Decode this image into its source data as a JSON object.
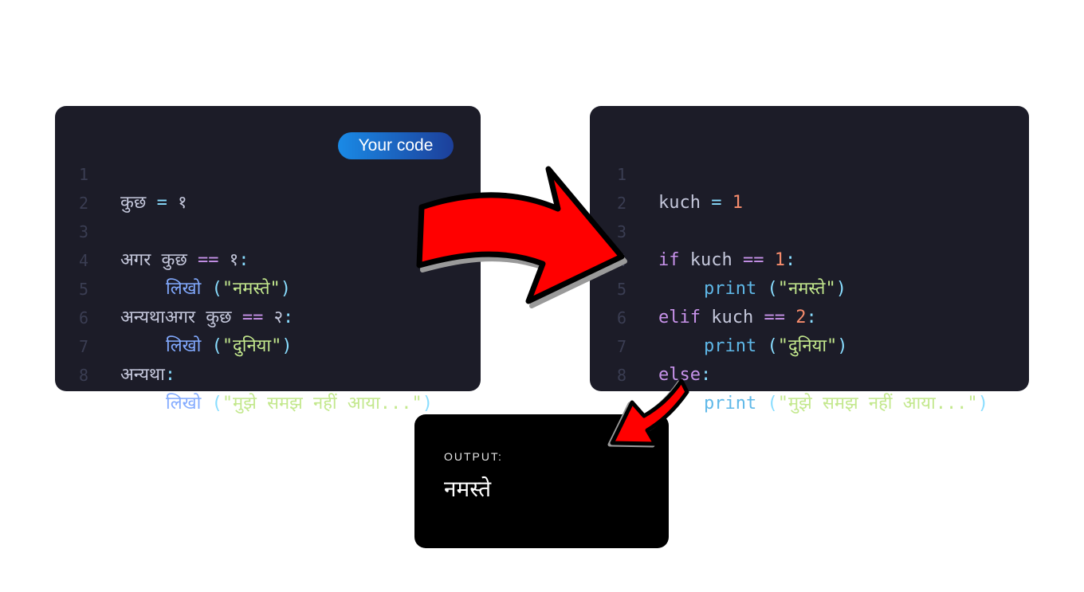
{
  "badge": {
    "label": "Your code",
    "gradient_start": "#1a8ae6",
    "gradient_end": "#1c3f9a"
  },
  "left_code": {
    "lines": [
      {
        "num": "1",
        "tokens": [
          "कुछ",
          "=",
          "१"
        ]
      },
      {
        "num": "2",
        "tokens": []
      },
      {
        "num": "3",
        "tokens": [
          "अगर",
          "कुछ",
          "==",
          "१",
          ":"
        ]
      },
      {
        "num": "4",
        "tokens": [
          "लिखो",
          "(",
          "\"नमस्ते\"",
          ")"
        ]
      },
      {
        "num": "5",
        "tokens": [
          "अन्यथाअगर",
          "कुछ",
          "==",
          "२",
          ":"
        ]
      },
      {
        "num": "6",
        "tokens": [
          "लिखो",
          "(",
          "\"दुनिया\"",
          ")"
        ]
      },
      {
        "num": "7",
        "tokens": [
          "अन्यथा",
          ":"
        ]
      },
      {
        "num": "8",
        "tokens": [
          "लिखो",
          "(",
          "\"मुझे समझ नहीं आया...\"",
          ")"
        ]
      }
    ]
  },
  "right_code": {
    "lines": [
      {
        "num": "1",
        "tokens": [
          "kuch",
          "=",
          "1"
        ]
      },
      {
        "num": "2",
        "tokens": []
      },
      {
        "num": "3",
        "tokens": [
          "if",
          "kuch",
          "==",
          "1",
          ":"
        ]
      },
      {
        "num": "4",
        "tokens": [
          "print",
          "(",
          "\"नमस्ते\"",
          ")"
        ]
      },
      {
        "num": "5",
        "tokens": [
          "elif",
          "kuch",
          "==",
          "2",
          ":"
        ]
      },
      {
        "num": "6",
        "tokens": [
          "print",
          "(",
          "\"दुनिया\"",
          ")"
        ]
      },
      {
        "num": "7",
        "tokens": [
          "else",
          ":"
        ]
      },
      {
        "num": "8",
        "tokens": [
          "print",
          "(",
          "\"मुझे समझ नहीं आया...\"",
          ")"
        ]
      }
    ]
  },
  "output": {
    "label": "OUTPUT:",
    "value": "नमस्ते"
  },
  "colors": {
    "panel_bg": "#1c1c28",
    "output_bg": "#000000",
    "arrow_fill": "#ff0000",
    "arrow_outline": "#000000",
    "keyword": "#c792ea",
    "function": "#5fb8e8",
    "string": "#c3e88d",
    "number": "#f78c6c",
    "operator": "#89ddff"
  },
  "icons": [
    "curved-arrow-right-icon",
    "curved-arrow-down-icon"
  ]
}
